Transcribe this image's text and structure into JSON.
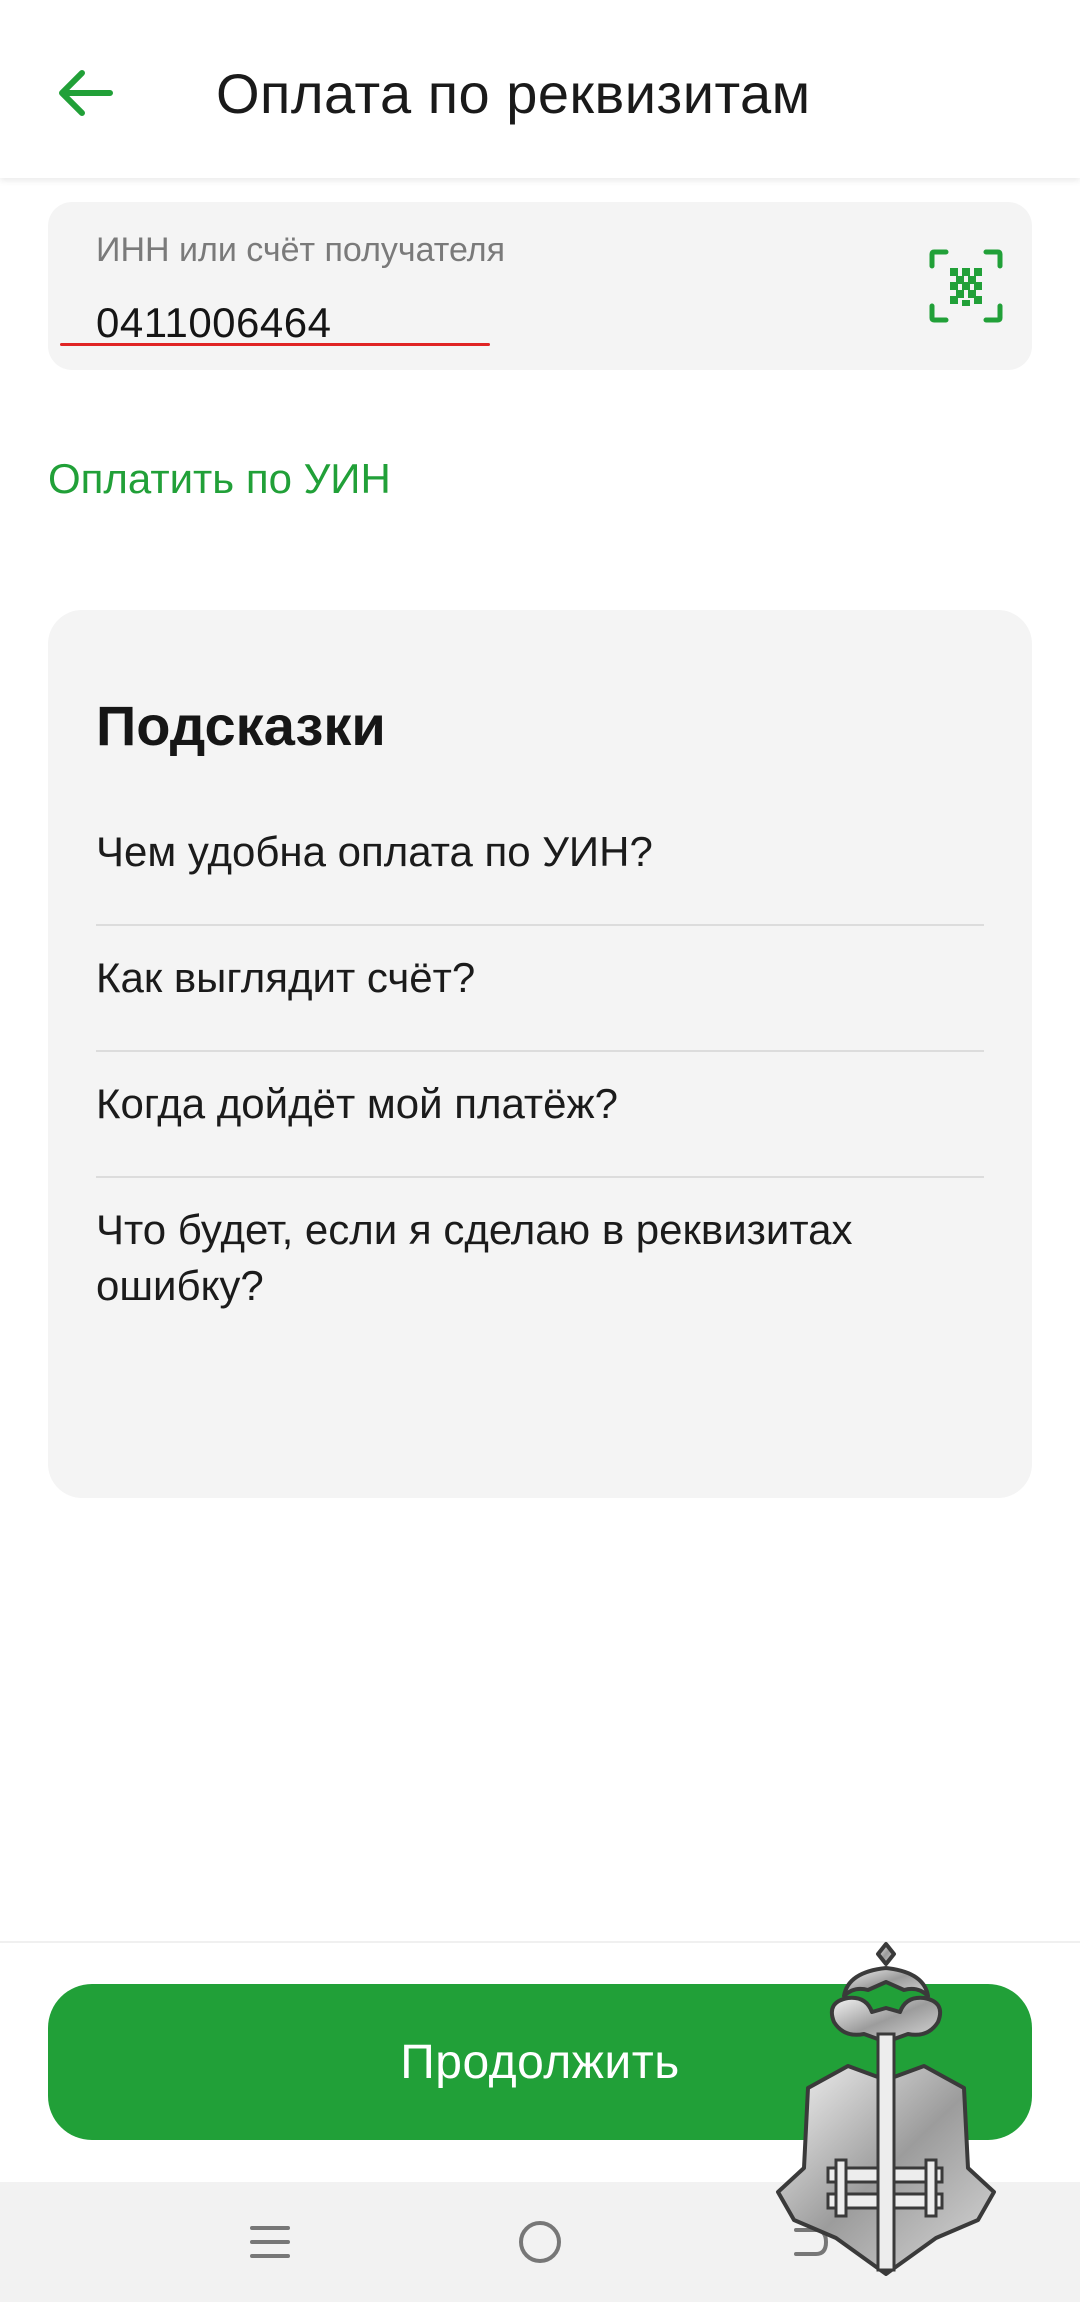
{
  "header": {
    "title": "Оплата по реквизитам",
    "back_icon": "arrow-left-icon",
    "accent_color": "#21a038"
  },
  "recipient_field": {
    "label": "ИНН или счёт получателя",
    "value": "0411006464",
    "scan_icon": "qr-scan-icon",
    "error_underline_color": "#e02424"
  },
  "uin_link": {
    "label": "Оплатить по УИН"
  },
  "hints": {
    "title": "Подсказки",
    "items": [
      "Чем удобна оплата по УИН?",
      "Как выглядит счёт?",
      "Когда дойдёт мой платёж?",
      "Что будет, если я сделаю в реквизитах ошибку?"
    ]
  },
  "continue_button": {
    "label": "Продолжить",
    "color": "#21a038"
  },
  "system_nav": {
    "icons": [
      "menu-icon",
      "home-circle-icon",
      "back-icon"
    ]
  },
  "watermark": {
    "icon": "key-emblem-watermark-icon"
  }
}
